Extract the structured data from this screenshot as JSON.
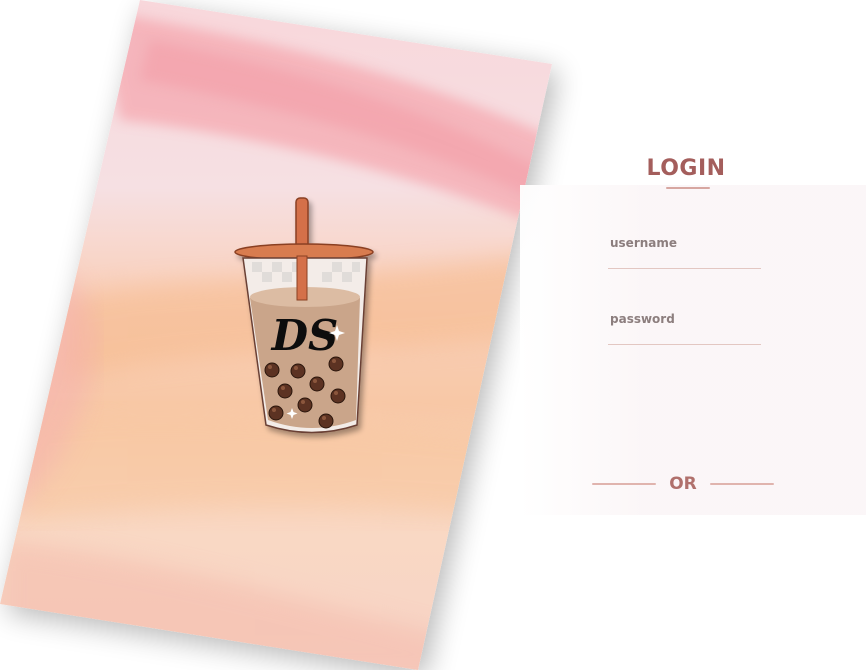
{
  "login": {
    "title": "LOGIN",
    "username_placeholder": "username",
    "password_placeholder": "password",
    "username_value": "",
    "password_value": "",
    "divider_text": "OR"
  },
  "logo": {
    "text": "DS"
  },
  "colors": {
    "title": "#a45e5c",
    "accent_line": "#d7a7a1",
    "placeholder": "#8c7e7e",
    "or_text": "#b0706c",
    "card_pink": "#f6b3b6",
    "card_peach": "#f7c49c",
    "straw": "#d4704a",
    "pearl": "#5c3320"
  }
}
